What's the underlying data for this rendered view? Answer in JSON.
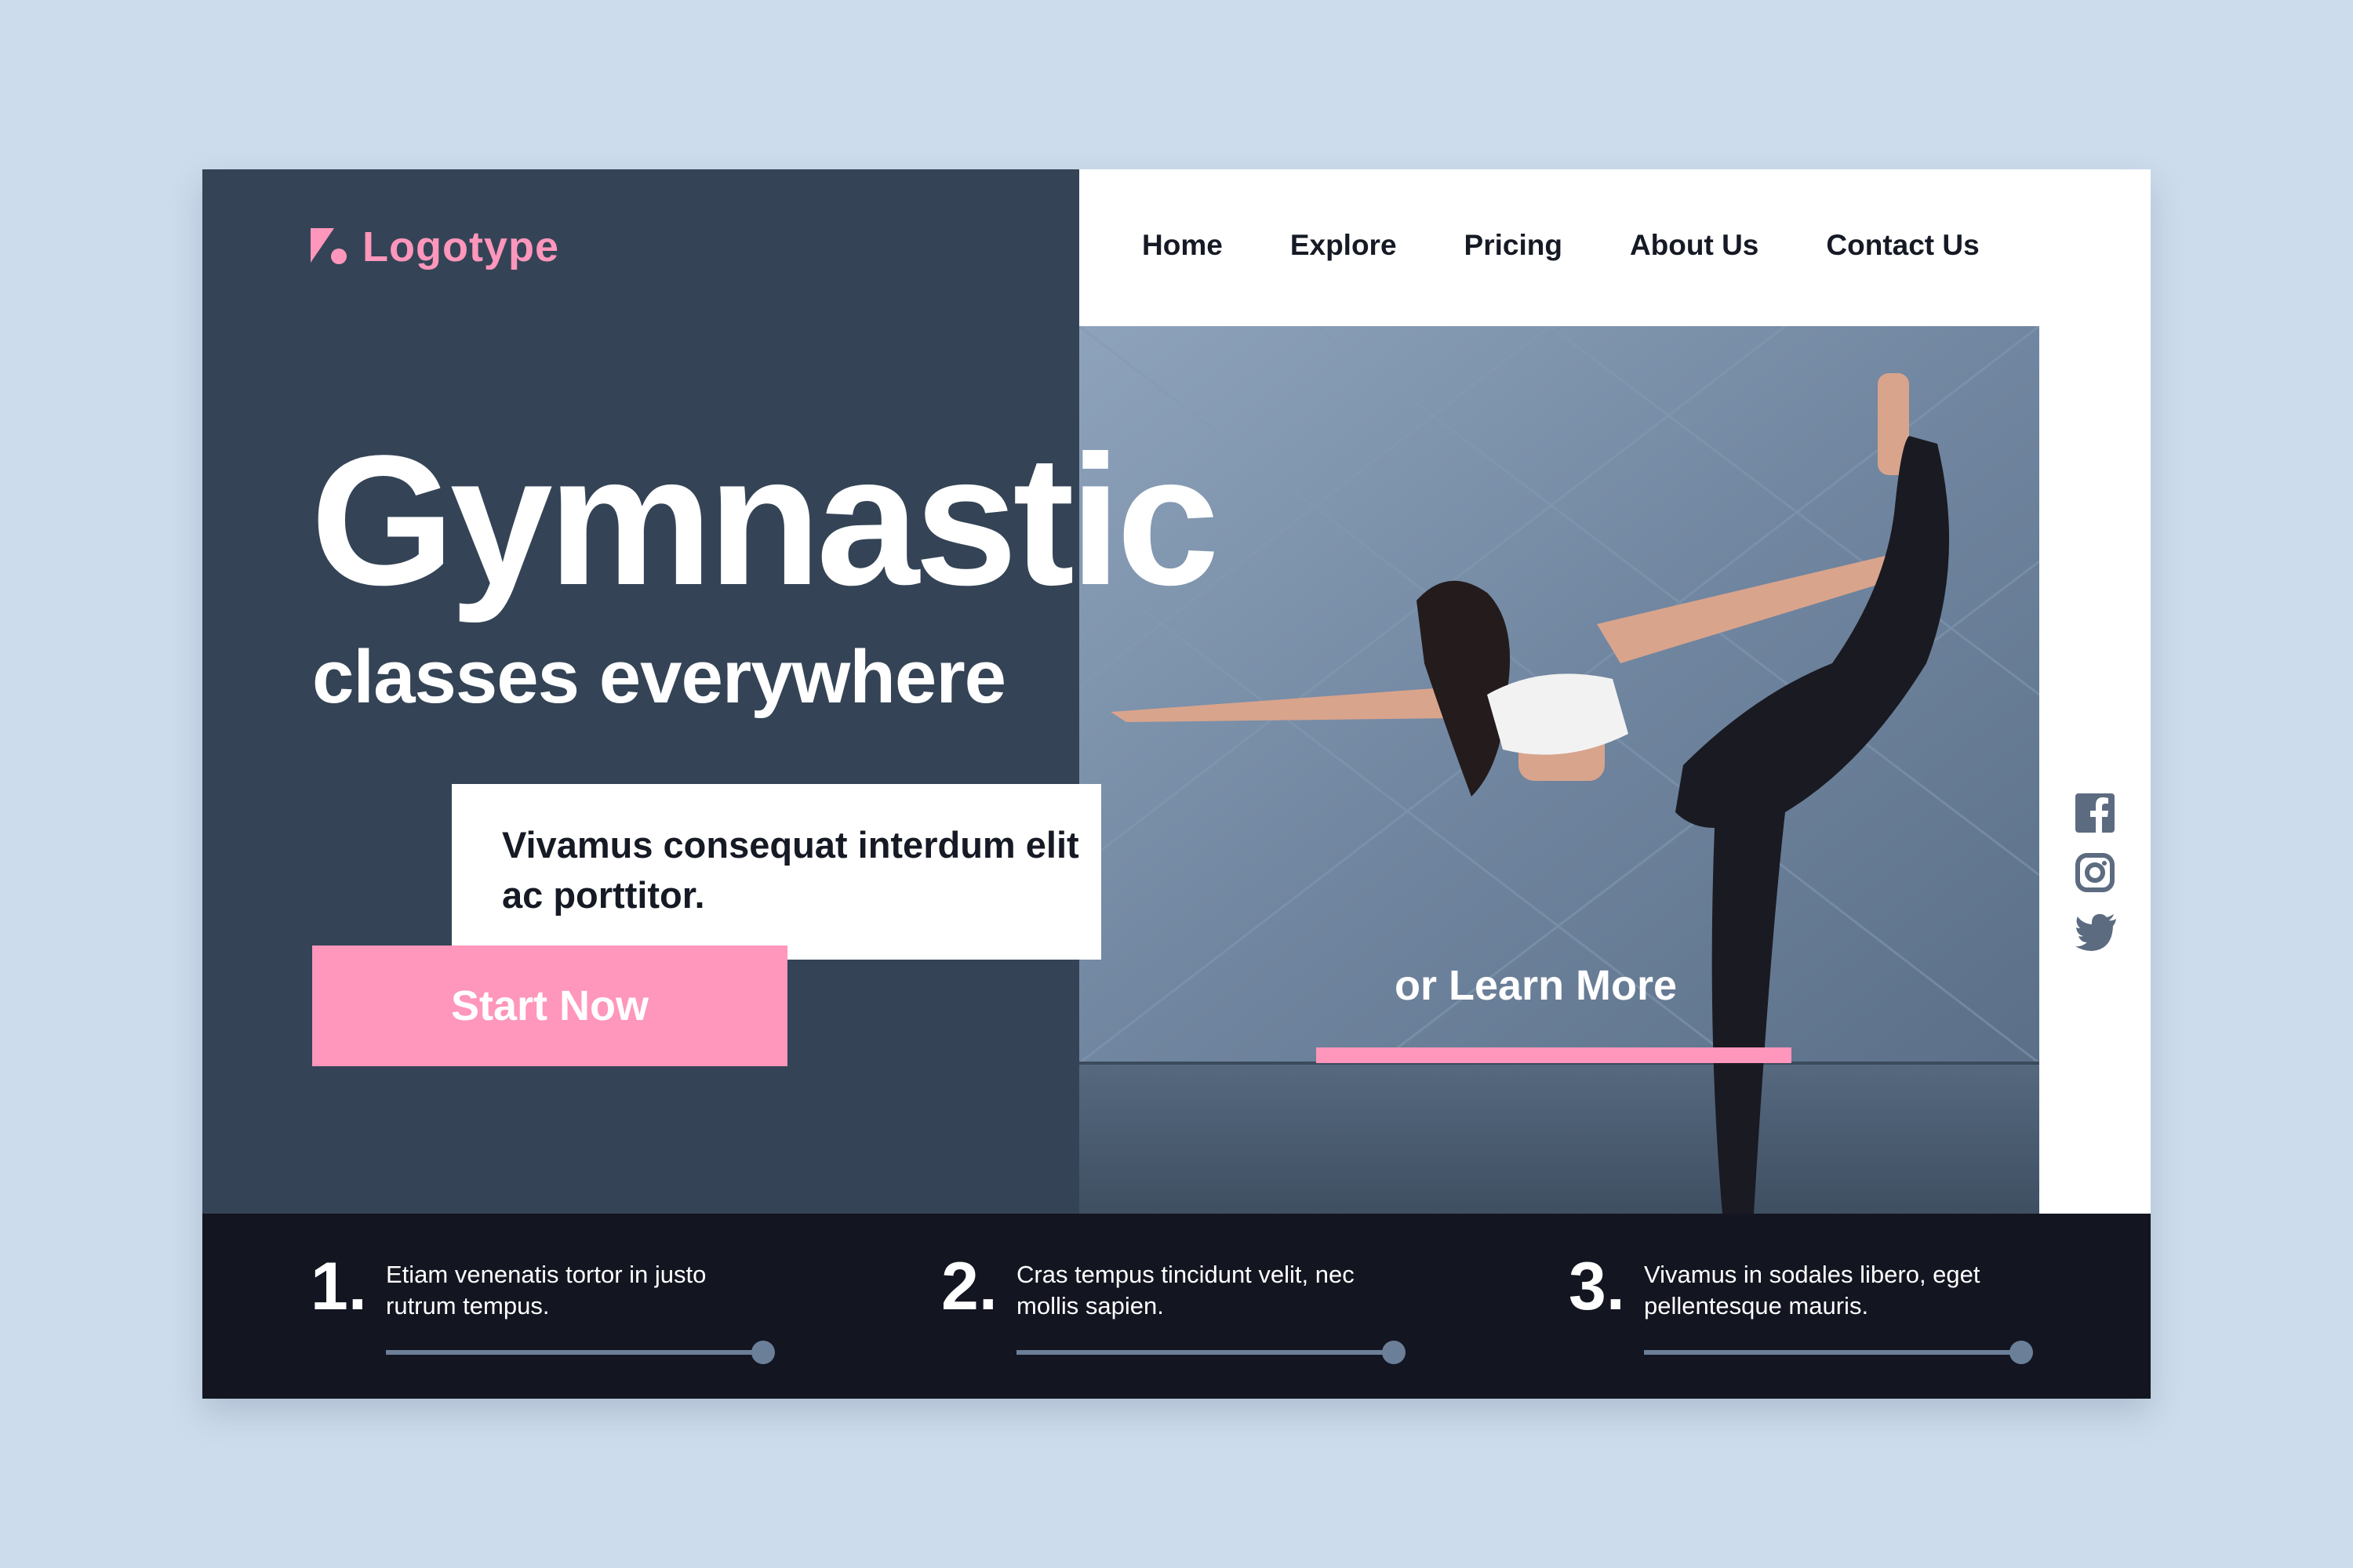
{
  "brand": {
    "logo_text": "Logotype",
    "accent_color": "#ff96bb",
    "dark_panel_color": "#344456",
    "footer_color": "#131521"
  },
  "nav": {
    "items": [
      "Home",
      "Explore",
      "Pricing",
      "About Us",
      "Contact Us"
    ]
  },
  "hero": {
    "title": "Gymnastic",
    "subtitle": "classes everywhere",
    "quote": "Vivamus consequat interdum elit ac porttitor.",
    "cta_primary": "Start Now",
    "cta_secondary": "or Learn More",
    "photo_icon": "gymnast-photo"
  },
  "social": {
    "icons": [
      "facebook-icon",
      "instagram-icon",
      "twitter-icon"
    ]
  },
  "steps": [
    {
      "number": "1.",
      "text": "Etiam venenatis tortor in justo rutrum tempus."
    },
    {
      "number": "2.",
      "text": "Cras tempus tincidunt velit, nec mollis sapien."
    },
    {
      "number": "3.",
      "text": "Vivamus in sodales libero, eget pellentesque mauris."
    }
  ]
}
